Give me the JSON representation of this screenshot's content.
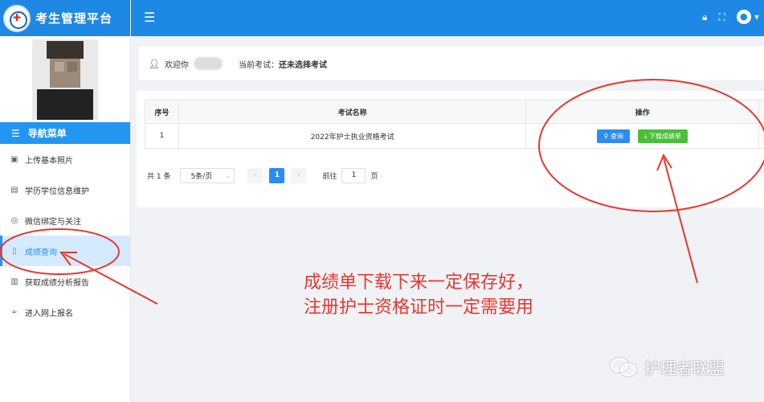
{
  "app": {
    "title": "考生管理平台"
  },
  "sidebar": {
    "nav_header": "导航菜单",
    "items": [
      {
        "label": "上传基本照片",
        "icon": "image-icon"
      },
      {
        "label": "学历学位信息维护",
        "icon": "book-icon"
      },
      {
        "label": "微信绑定与关注",
        "icon": "wechat-icon"
      },
      {
        "label": "成绩查询",
        "icon": "document-icon",
        "active": true
      },
      {
        "label": "获取成绩分析报告",
        "icon": "report-icon"
      },
      {
        "label": "进入网上报名",
        "icon": "send-icon"
      }
    ]
  },
  "welcome": {
    "greeting": "欢迎你",
    "exam_label": "当前考试：",
    "exam_value": "还未选择考试"
  },
  "table": {
    "headers": [
      "序号",
      "考试名称",
      "操作"
    ],
    "rows": [
      {
        "no": "1",
        "name": "2022年护士执业资格考试",
        "query_label": "查询",
        "download_label": "下载成绩单"
      }
    ]
  },
  "pagination": {
    "total": "共 1 条",
    "page_size": "5条/页",
    "prev": "‹",
    "current_page": "1",
    "next": "›",
    "goto_label": "前往",
    "goto_value": "1",
    "goto_suffix": "页"
  },
  "annotation": {
    "line1": "成绩单下载下来一定保存好，",
    "line2": "注册护士资格证时一定需要用",
    "color": "#e8372f"
  },
  "watermark": {
    "text": "护理者联盟"
  },
  "colors": {
    "primary": "#1e88e5",
    "active_bg": "#d6eaff",
    "query_button": "#2d8cf0",
    "download_button": "#4cbe3a"
  }
}
